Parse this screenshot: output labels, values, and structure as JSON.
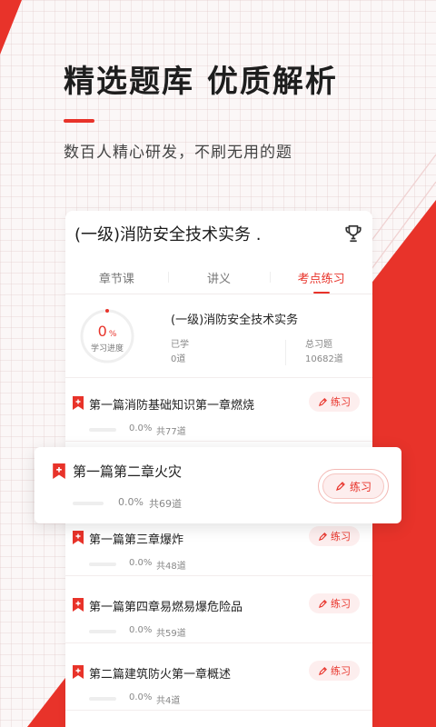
{
  "hero": {
    "title": "精选题库  优质解析",
    "subtitle": "数百人精心研发，不刷无用的题"
  },
  "course": {
    "title": "(一级)消防安全技术实务 .",
    "tabs": [
      {
        "label": "章节课",
        "active": false
      },
      {
        "label": "讲义",
        "active": false
      },
      {
        "label": "考点练习",
        "active": true
      }
    ]
  },
  "summary": {
    "progress_value": "0",
    "progress_unit": "%",
    "progress_label": "学习进度",
    "title": "(一级)消防安全技术实务",
    "learned_label": "已学",
    "learned_value": "0道",
    "total_label": "总习题",
    "total_value": "10682道"
  },
  "chapters": [
    {
      "title": "第一篇消防基础知识第一章燃烧",
      "pct": "0.0%",
      "total": "共77道",
      "progress": 0,
      "button": "练习"
    },
    {
      "title": "第一篇第二章火灾",
      "pct": "0.0%",
      "total": "共69道",
      "progress": 0,
      "button": "练习"
    },
    {
      "title": "第一篇第三章爆炸",
      "pct": "0.0%",
      "total": "共48道",
      "progress": 0,
      "button": "练习"
    },
    {
      "title": "第一篇第四章易燃易爆危险品",
      "pct": "0.0%",
      "total": "共59道",
      "progress": 0,
      "button": "练习"
    },
    {
      "title": "第二篇建筑防火第一章概述",
      "pct": "0.0%",
      "total": "共4道",
      "progress": 0,
      "button": "练习"
    }
  ],
  "colors": {
    "accent": "#e8332a",
    "accent_soft": "#fdeeee",
    "background": "#fbf7f7"
  },
  "icons": {
    "trophy": "trophy-icon",
    "bookmark": "bookmark-plus-icon",
    "pencil": "pencil-icon"
  }
}
